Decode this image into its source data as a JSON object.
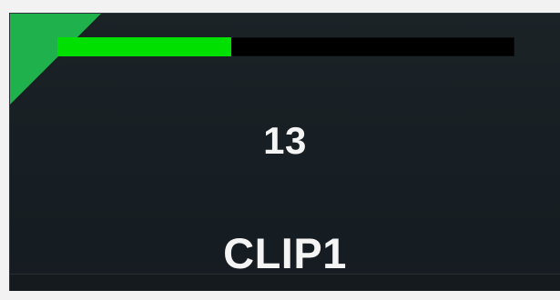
{
  "clip": {
    "value": "13",
    "name": "CLIP1",
    "progress_percent": 38
  },
  "colors": {
    "progress": "#00e000",
    "corner_marker": "#1fb14c",
    "background": "#171f24"
  }
}
